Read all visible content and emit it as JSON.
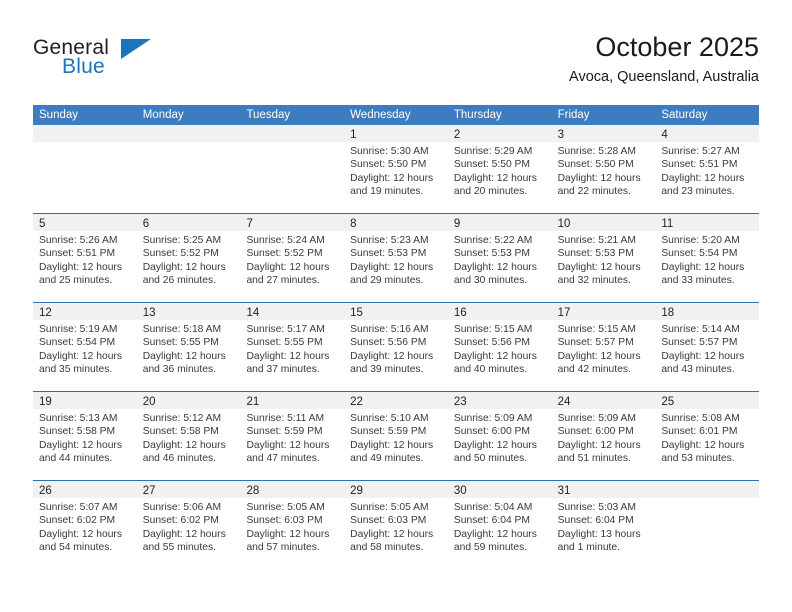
{
  "brand": {
    "name_top": "General",
    "name_bottom": "Blue",
    "triangle_color": "#1b75bc",
    "top_color": "#231f20",
    "bottom_color": "#1b75bc"
  },
  "header": {
    "month_title": "October 2025",
    "location": "Avoca, Queensland, Australia"
  },
  "theme": {
    "header_bar_color": "#3c7cbf",
    "row_divider_color": "#2f6fb2",
    "day_band_color": "#f1f1f1",
    "text_color": "#3a3a3a"
  },
  "calendar": {
    "weekday_headers": [
      "Sunday",
      "Monday",
      "Tuesday",
      "Wednesday",
      "Thursday",
      "Friday",
      "Saturday"
    ],
    "weeks": [
      [
        {
          "day": "",
          "empty": true,
          "sunrise": "",
          "sunset": "",
          "daylight_1": "",
          "daylight_2": ""
        },
        {
          "day": "",
          "empty": true,
          "sunrise": "",
          "sunset": "",
          "daylight_1": "",
          "daylight_2": ""
        },
        {
          "day": "",
          "empty": true,
          "sunrise": "",
          "sunset": "",
          "daylight_1": "",
          "daylight_2": ""
        },
        {
          "day": "1",
          "empty": false,
          "sunrise": "Sunrise: 5:30 AM",
          "sunset": "Sunset: 5:50 PM",
          "daylight_1": "Daylight: 12 hours",
          "daylight_2": "and 19 minutes."
        },
        {
          "day": "2",
          "empty": false,
          "sunrise": "Sunrise: 5:29 AM",
          "sunset": "Sunset: 5:50 PM",
          "daylight_1": "Daylight: 12 hours",
          "daylight_2": "and 20 minutes."
        },
        {
          "day": "3",
          "empty": false,
          "sunrise": "Sunrise: 5:28 AM",
          "sunset": "Sunset: 5:50 PM",
          "daylight_1": "Daylight: 12 hours",
          "daylight_2": "and 22 minutes."
        },
        {
          "day": "4",
          "empty": false,
          "sunrise": "Sunrise: 5:27 AM",
          "sunset": "Sunset: 5:51 PM",
          "daylight_1": "Daylight: 12 hours",
          "daylight_2": "and 23 minutes."
        }
      ],
      [
        {
          "day": "5",
          "empty": false,
          "sunrise": "Sunrise: 5:26 AM",
          "sunset": "Sunset: 5:51 PM",
          "daylight_1": "Daylight: 12 hours",
          "daylight_2": "and 25 minutes."
        },
        {
          "day": "6",
          "empty": false,
          "sunrise": "Sunrise: 5:25 AM",
          "sunset": "Sunset: 5:52 PM",
          "daylight_1": "Daylight: 12 hours",
          "daylight_2": "and 26 minutes."
        },
        {
          "day": "7",
          "empty": false,
          "sunrise": "Sunrise: 5:24 AM",
          "sunset": "Sunset: 5:52 PM",
          "daylight_1": "Daylight: 12 hours",
          "daylight_2": "and 27 minutes."
        },
        {
          "day": "8",
          "empty": false,
          "sunrise": "Sunrise: 5:23 AM",
          "sunset": "Sunset: 5:53 PM",
          "daylight_1": "Daylight: 12 hours",
          "daylight_2": "and 29 minutes."
        },
        {
          "day": "9",
          "empty": false,
          "sunrise": "Sunrise: 5:22 AM",
          "sunset": "Sunset: 5:53 PM",
          "daylight_1": "Daylight: 12 hours",
          "daylight_2": "and 30 minutes."
        },
        {
          "day": "10",
          "empty": false,
          "sunrise": "Sunrise: 5:21 AM",
          "sunset": "Sunset: 5:53 PM",
          "daylight_1": "Daylight: 12 hours",
          "daylight_2": "and 32 minutes."
        },
        {
          "day": "11",
          "empty": false,
          "sunrise": "Sunrise: 5:20 AM",
          "sunset": "Sunset: 5:54 PM",
          "daylight_1": "Daylight: 12 hours",
          "daylight_2": "and 33 minutes."
        }
      ],
      [
        {
          "day": "12",
          "empty": false,
          "sunrise": "Sunrise: 5:19 AM",
          "sunset": "Sunset: 5:54 PM",
          "daylight_1": "Daylight: 12 hours",
          "daylight_2": "and 35 minutes."
        },
        {
          "day": "13",
          "empty": false,
          "sunrise": "Sunrise: 5:18 AM",
          "sunset": "Sunset: 5:55 PM",
          "daylight_1": "Daylight: 12 hours",
          "daylight_2": "and 36 minutes."
        },
        {
          "day": "14",
          "empty": false,
          "sunrise": "Sunrise: 5:17 AM",
          "sunset": "Sunset: 5:55 PM",
          "daylight_1": "Daylight: 12 hours",
          "daylight_2": "and 37 minutes."
        },
        {
          "day": "15",
          "empty": false,
          "sunrise": "Sunrise: 5:16 AM",
          "sunset": "Sunset: 5:56 PM",
          "daylight_1": "Daylight: 12 hours",
          "daylight_2": "and 39 minutes."
        },
        {
          "day": "16",
          "empty": false,
          "sunrise": "Sunrise: 5:15 AM",
          "sunset": "Sunset: 5:56 PM",
          "daylight_1": "Daylight: 12 hours",
          "daylight_2": "and 40 minutes."
        },
        {
          "day": "17",
          "empty": false,
          "sunrise": "Sunrise: 5:15 AM",
          "sunset": "Sunset: 5:57 PM",
          "daylight_1": "Daylight: 12 hours",
          "daylight_2": "and 42 minutes."
        },
        {
          "day": "18",
          "empty": false,
          "sunrise": "Sunrise: 5:14 AM",
          "sunset": "Sunset: 5:57 PM",
          "daylight_1": "Daylight: 12 hours",
          "daylight_2": "and 43 minutes."
        }
      ],
      [
        {
          "day": "19",
          "empty": false,
          "sunrise": "Sunrise: 5:13 AM",
          "sunset": "Sunset: 5:58 PM",
          "daylight_1": "Daylight: 12 hours",
          "daylight_2": "and 44 minutes."
        },
        {
          "day": "20",
          "empty": false,
          "sunrise": "Sunrise: 5:12 AM",
          "sunset": "Sunset: 5:58 PM",
          "daylight_1": "Daylight: 12 hours",
          "daylight_2": "and 46 minutes."
        },
        {
          "day": "21",
          "empty": false,
          "sunrise": "Sunrise: 5:11 AM",
          "sunset": "Sunset: 5:59 PM",
          "daylight_1": "Daylight: 12 hours",
          "daylight_2": "and 47 minutes."
        },
        {
          "day": "22",
          "empty": false,
          "sunrise": "Sunrise: 5:10 AM",
          "sunset": "Sunset: 5:59 PM",
          "daylight_1": "Daylight: 12 hours",
          "daylight_2": "and 49 minutes."
        },
        {
          "day": "23",
          "empty": false,
          "sunrise": "Sunrise: 5:09 AM",
          "sunset": "Sunset: 6:00 PM",
          "daylight_1": "Daylight: 12 hours",
          "daylight_2": "and 50 minutes."
        },
        {
          "day": "24",
          "empty": false,
          "sunrise": "Sunrise: 5:09 AM",
          "sunset": "Sunset: 6:00 PM",
          "daylight_1": "Daylight: 12 hours",
          "daylight_2": "and 51 minutes."
        },
        {
          "day": "25",
          "empty": false,
          "sunrise": "Sunrise: 5:08 AM",
          "sunset": "Sunset: 6:01 PM",
          "daylight_1": "Daylight: 12 hours",
          "daylight_2": "and 53 minutes."
        }
      ],
      [
        {
          "day": "26",
          "empty": false,
          "sunrise": "Sunrise: 5:07 AM",
          "sunset": "Sunset: 6:02 PM",
          "daylight_1": "Daylight: 12 hours",
          "daylight_2": "and 54 minutes."
        },
        {
          "day": "27",
          "empty": false,
          "sunrise": "Sunrise: 5:06 AM",
          "sunset": "Sunset: 6:02 PM",
          "daylight_1": "Daylight: 12 hours",
          "daylight_2": "and 55 minutes."
        },
        {
          "day": "28",
          "empty": false,
          "sunrise": "Sunrise: 5:05 AM",
          "sunset": "Sunset: 6:03 PM",
          "daylight_1": "Daylight: 12 hours",
          "daylight_2": "and 57 minutes."
        },
        {
          "day": "29",
          "empty": false,
          "sunrise": "Sunrise: 5:05 AM",
          "sunset": "Sunset: 6:03 PM",
          "daylight_1": "Daylight: 12 hours",
          "daylight_2": "and 58 minutes."
        },
        {
          "day": "30",
          "empty": false,
          "sunrise": "Sunrise: 5:04 AM",
          "sunset": "Sunset: 6:04 PM",
          "daylight_1": "Daylight: 12 hours",
          "daylight_2": "and 59 minutes."
        },
        {
          "day": "31",
          "empty": false,
          "sunrise": "Sunrise: 5:03 AM",
          "sunset": "Sunset: 6:04 PM",
          "daylight_1": "Daylight: 13 hours",
          "daylight_2": "and 1 minute."
        },
        {
          "day": "",
          "empty": true,
          "sunrise": "",
          "sunset": "",
          "daylight_1": "",
          "daylight_2": ""
        }
      ]
    ]
  }
}
